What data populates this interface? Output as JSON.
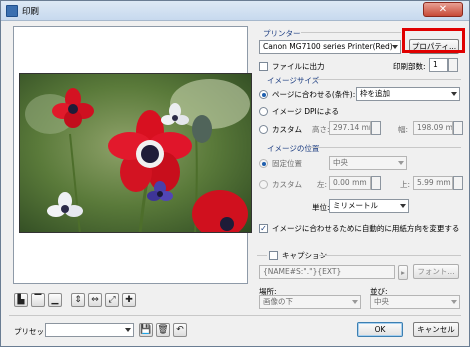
{
  "window": {
    "title": "印刷",
    "close_glyph": "✕"
  },
  "printer": {
    "section_label": "プリンター",
    "selected": "Canon MG7100 series Printer(Red)",
    "properties_label": "プロパティ...",
    "print_to_file_label": "ファイルに出力",
    "copies_label": "印刷部数:",
    "copies_value": "1"
  },
  "image_size": {
    "section_label": "イメージサイズ",
    "fit_page_label": "ページに合わせる(条件):",
    "fit_page_option": "枠を追加",
    "image_dpi_label": "イメージ DPIによる",
    "custom_label": "カスタム",
    "height_label": "高さ:",
    "height_value": "297.14 mm",
    "width_label": "幅:",
    "width_value": "198.09 mm"
  },
  "image_position": {
    "section_label": "イメージの位置",
    "fixed_label": "固定位置",
    "fixed_value": "中央",
    "custom_label": "カスタム",
    "left_label": "左:",
    "left_value": "0.00 mm",
    "top_label": "上:",
    "top_value": "5.99 mm",
    "unit_label": "単位:",
    "unit_value": "ミリメートル"
  },
  "auto_rotate_label": "イメージに合わせるために自動的に用紙方向を変更する",
  "caption": {
    "label": "キャプション",
    "value": "{NAME#S:\".\"}{EXT}",
    "font_button": "フォント..."
  },
  "placement": {
    "label": "場所:",
    "value": "画像の下",
    "align_label": "並び:",
    "align_value": "中央"
  },
  "preset": {
    "label": "プリセット:",
    "value": ""
  },
  "ok_label": "OK",
  "cancel_label": "キャンセル",
  "check_glyph": "✓",
  "layout_icons": [
    "align-bottom-left",
    "align-top",
    "align-bottom",
    "fit-height",
    "fit-width",
    "fit-both",
    "align-center"
  ],
  "layout_glyphs": [
    "▙",
    "▔",
    "▁",
    "⇕",
    "⇔",
    "⤢",
    "✚"
  ],
  "preset_glyphs": {
    "save": "💾",
    "delete": "🗑",
    "undo": "↶"
  }
}
